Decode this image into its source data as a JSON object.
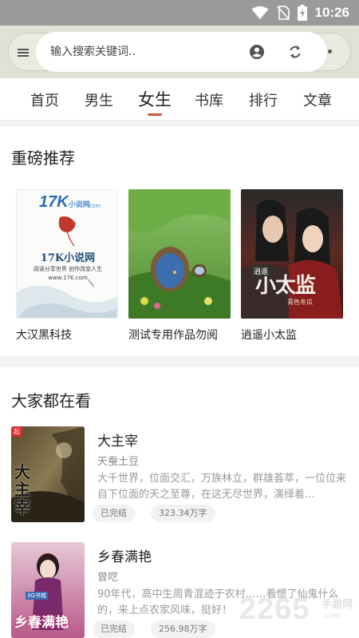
{
  "status_bar": {
    "time": "10:26",
    "icons": [
      "wifi-icon",
      "no-sim-icon",
      "battery-charging-icon"
    ]
  },
  "search": {
    "placeholder": "输入搜索关键词.."
  },
  "tabs": [
    {
      "label": "首页",
      "active": false
    },
    {
      "label": "男生",
      "active": false
    },
    {
      "label": "女生",
      "active": true
    },
    {
      "label": "书库",
      "active": false
    },
    {
      "label": "排行",
      "active": false
    },
    {
      "label": "文章",
      "active": false
    }
  ],
  "featured": {
    "title": "重磅推荐",
    "books": [
      {
        "title": "大汉黑科技",
        "cover_text": {
          "logo": "17K",
          "logo_sub": "小说网",
          "logo_url": ".com",
          "name": "17K小说网",
          "slogan": "阅读分享世界 创作改变人生",
          "url": "www.17K.com"
        }
      },
      {
        "title": "测试专用作品勿阅"
      },
      {
        "title": "逍遥小太监",
        "cover_text": {
          "big": "小太监",
          "small": "逍遥",
          "author": "青色冬瓜"
        }
      }
    ]
  },
  "popular": {
    "title": "大家都在看",
    "books": [
      {
        "title": "大主宰",
        "author": "天蚕土豆",
        "description": "大千世界，位面交汇，万族林立，群雄荟萃，一位位来自下位面的天之至尊，在这无尽世界，演绎着...",
        "status": "已完结",
        "word_count": "323.34万字",
        "cover_text": {
          "big": "大主宰",
          "badge": "起"
        }
      },
      {
        "title": "乡春满艳",
        "author": "曾呓",
        "description": "90年代，高中生周青混迹于农村……看惯了仙鬼什么的，来上点农家风味，挺好！",
        "status": "已完结",
        "word_count": "256.98万字",
        "cover_text": {
          "big": "乡春满艳",
          "badge": "3G书城"
        }
      }
    ]
  },
  "watermark": {
    "number": "2265",
    "site": "手游网",
    "url": ".com"
  },
  "colors": {
    "accent": "#c45a3a",
    "search_bg": "#dfe3d6",
    "status_bar": "#9a9a9a"
  }
}
